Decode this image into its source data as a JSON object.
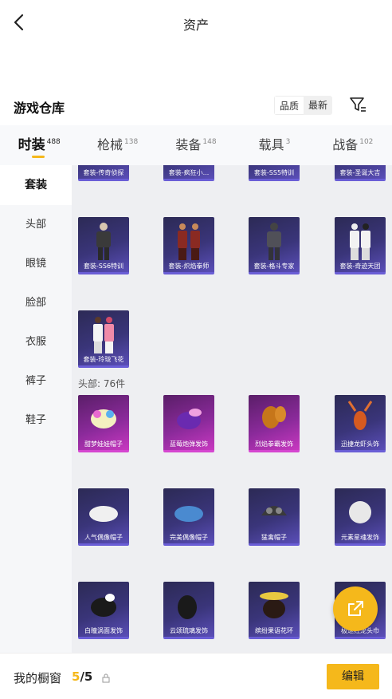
{
  "header": {
    "title": "资产"
  },
  "warehouse": {
    "title": "游戏仓库",
    "sort_quality": "品质",
    "sort_latest": "最新"
  },
  "tabs": [
    {
      "label": "时装",
      "count": "488",
      "active": true
    },
    {
      "label": "枪械",
      "count": "138"
    },
    {
      "label": "装备",
      "count": "148"
    },
    {
      "label": "载具",
      "count": "3"
    },
    {
      "label": "战备",
      "count": "102"
    }
  ],
  "sidenav": [
    "套装",
    "头部",
    "眼镜",
    "脸部",
    "衣服",
    "裤子",
    "鞋子"
  ],
  "sections": {
    "head_label": "头部: 76件"
  },
  "items": {
    "top_row": [
      "套装-传奇侦探",
      "套装-疯狂小...",
      "套装-SS5特训",
      "套装-圣诞大吉"
    ],
    "suits_row1": [
      "套装-SS6特训",
      "套装-炽焰拳师",
      "套装-格斗专家",
      "套装-奇迹天团"
    ],
    "suits_row2": [
      "套装-玲珑飞花"
    ],
    "head_row1": [
      "甜梦娃娃帽子",
      "蓝莓炮弹发饰",
      "烈焰拳霸发饰",
      "迅捷龙虾头饰"
    ],
    "head_row2": [
      "人气偶像帽子",
      "完美偶像帽子",
      "猛禽帽子",
      "元素星魂发饰"
    ],
    "head_row3": [
      "白瞳涡面发饰",
      "云颂琉璃发饰",
      "缤纷果语花环",
      "极速红龙头巾"
    ]
  },
  "bottom": {
    "window_label": "我的橱窗",
    "window_current": "5",
    "window_sep_total": "/5",
    "edit_label": "编辑"
  },
  "colors": {
    "accent": "#f5b81b",
    "rarity_purple": "#5a4eb8",
    "rarity_pink": "#c838c0"
  }
}
